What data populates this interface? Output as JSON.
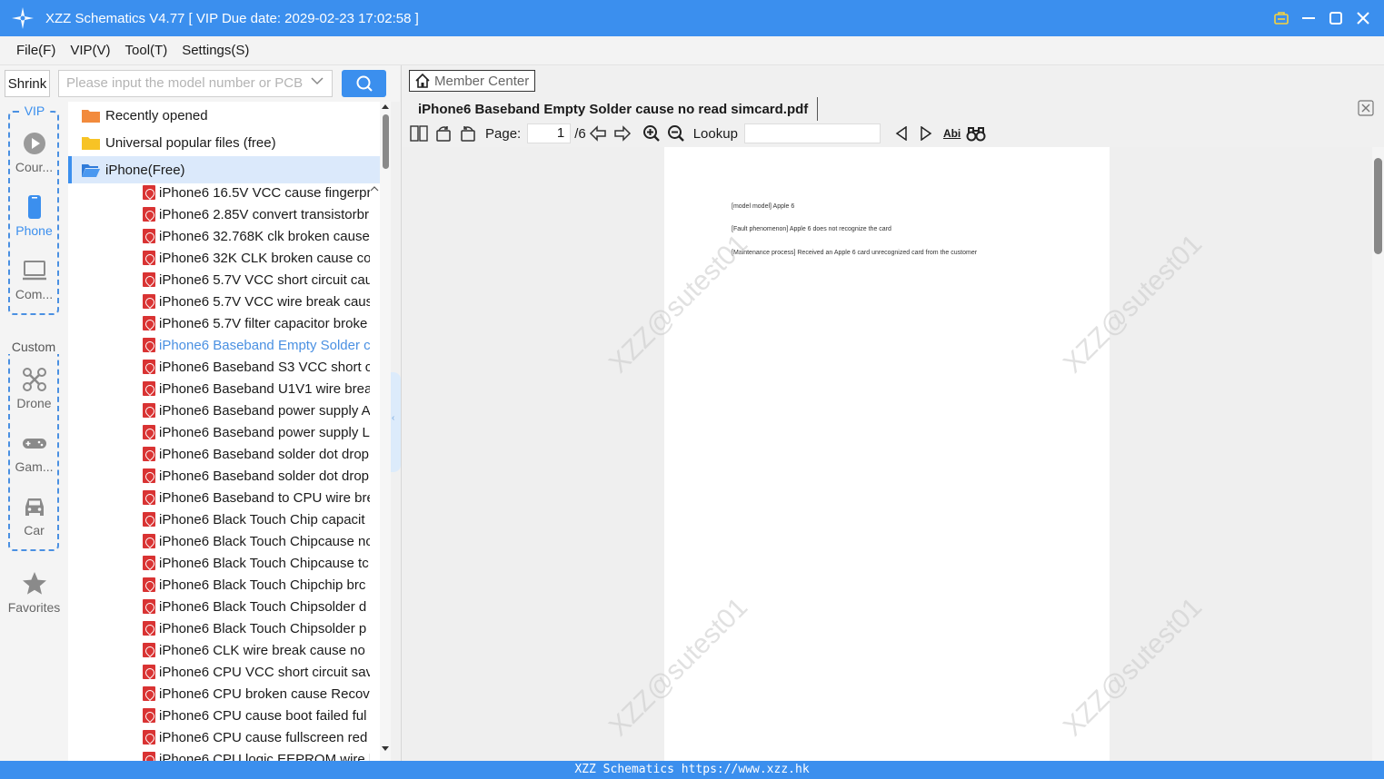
{
  "window": {
    "title": "XZZ Schematics V4.77 [ VIP Due date: 2029-02-23 17:02:58 ]"
  },
  "menu": [
    "File(F)",
    "VIP(V)",
    "Tool(T)",
    "Settings(S)"
  ],
  "search": {
    "shrink_label": "Shrink",
    "placeholder": "Please input the model number or PCB"
  },
  "leftnav": {
    "vip_label": "VIP",
    "vip_items": [
      {
        "label": "Cour...",
        "icon": "play-circle-icon"
      },
      {
        "label": "Phone",
        "icon": "phone-icon",
        "active": true
      },
      {
        "label": "Com...",
        "icon": "laptop-icon"
      }
    ],
    "custom_label": "Custom",
    "custom_items": [
      {
        "label": "Drone",
        "icon": "drone-icon"
      },
      {
        "label": "Gam...",
        "icon": "gamepad-icon"
      },
      {
        "label": "Car",
        "icon": "car-icon"
      }
    ],
    "favorites_label": "Favorites"
  },
  "tree": {
    "folders": [
      "Recently opened",
      "Universal popular files (free)",
      "iPhone(Free)"
    ],
    "files": [
      "iPhone6 16.5V VCC cause fingerpri",
      "iPhone6 2.85V convert transistorbr",
      "iPhone6 32.768K clk broken cause",
      "iPhone6 32K CLK broken cause coi",
      "iPhone6 5.7V VCC short circuit cau",
      "iPhone6 5.7V VCC wire break  caus",
      "iPhone6 5.7V filter capacitor broke",
      "iPhone6 Baseband Empty Solder c",
      "iPhone6 Baseband S3 VCC short ci",
      "iPhone6 Baseband U1V1 wire brea",
      "iPhone6 Baseband power supply A",
      "iPhone6 Baseband power supply L",
      "iPhone6 Baseband solder dot drop",
      "iPhone6 Baseband solder dot drop",
      "iPhone6 Baseband to CPU wire bre",
      "iPhone6 Black Touch Chip capacit",
      "iPhone6 Black Touch Chipcause nc",
      "iPhone6 Black Touch Chipcause tc",
      "iPhone6 Black Touch Chipchip brc",
      "iPhone6 Black Touch Chipsolder d",
      "iPhone6 Black Touch Chipsolder p",
      "iPhone6 CLK wire break  cause no",
      "iPhone6 CPU VCC short circuit save",
      "iPhone6 CPU broken cause Recove",
      "iPhone6 CPU cause boot failed ful",
      "iPhone6 CPU cause fullscreen red ;",
      "iPhone6 CPU logic EEPROM wire b"
    ],
    "highlight_index": 7
  },
  "viewer": {
    "member_center": "Member Center",
    "tab_title": "iPhone6 Baseband Empty Solder cause no read simcard.pdf",
    "page_label": "Page:",
    "page_current": "1",
    "page_total": "/6",
    "lookup_label": "Lookup",
    "abi_label": "Abi",
    "doc_lines": [
      "[model model] Apple 6",
      "[Fault phenomenon] Apple 6 does not recognize the card",
      "[Maintenance process] Received an Apple 6 card unrecognized card from the customer"
    ],
    "watermark": "XZZ@sutest01"
  },
  "status": {
    "text": "XZZ Schematics https://www.xzz.hk"
  },
  "colors": {
    "accent": "#3b8fee",
    "pdf_icon": "#d93333",
    "folder_orange": "#f28a3c",
    "folder_yellow": "#f7c325"
  }
}
